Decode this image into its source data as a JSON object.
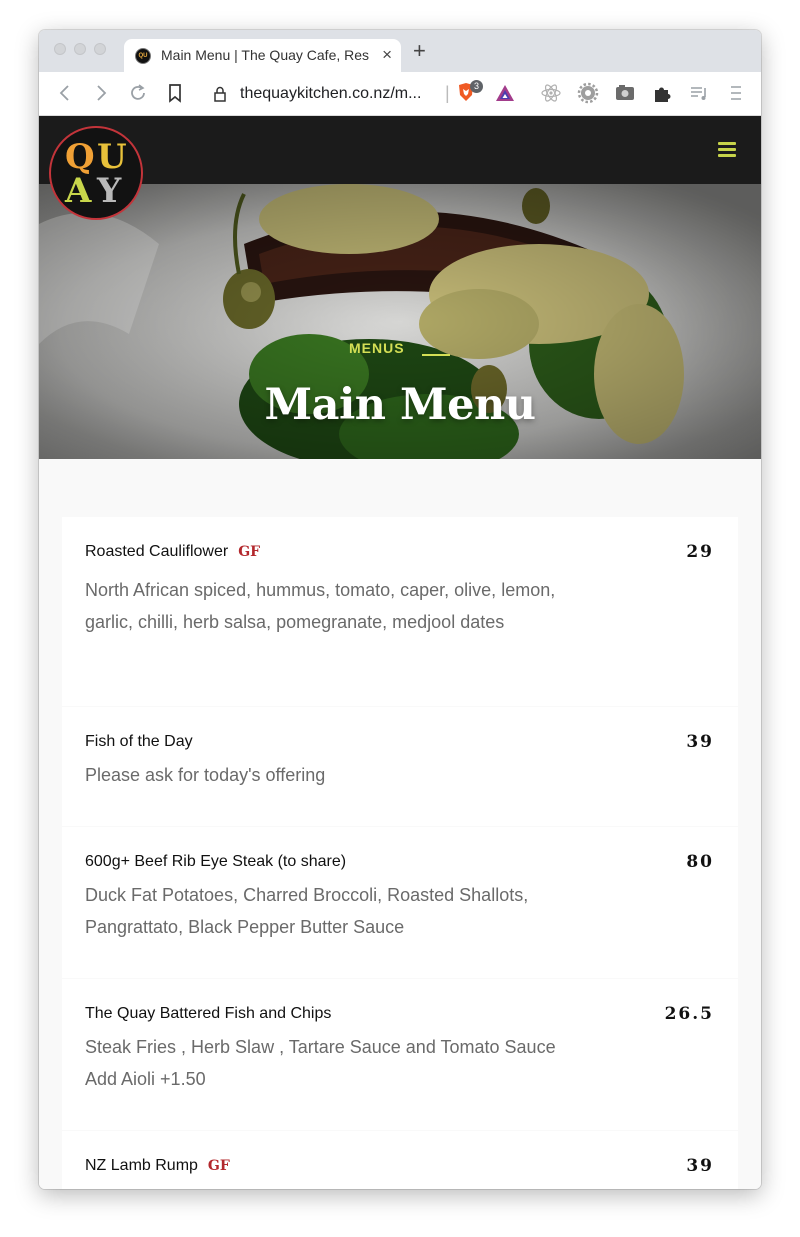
{
  "browser": {
    "tab_title": "Main Menu | The Quay Cafe, Res",
    "tab_close": "×",
    "new_tab": "+",
    "url": "thequaykitchen.co.nz/m...",
    "url_separator": "|",
    "brave_badge_count": "3"
  },
  "site": {
    "logo_letters": [
      "Q",
      "U",
      "A",
      "Y"
    ],
    "logo_colors": [
      "#f0a035",
      "#e8c13a",
      "#c8d64b",
      "#b9b9b9"
    ],
    "accent_color": "#d4df55",
    "price_accent_color": "#b3282d"
  },
  "hero": {
    "category": "MENUS",
    "title": "Main Menu"
  },
  "menu": {
    "items": [
      {
        "name": "Roasted Cauliflower",
        "badge": "GF",
        "price": "29",
        "description": "North African spiced, hummus, tomato, caper, olive, lemon, garlic, chilli, herb salsa, pomegranate, medjool dates"
      },
      {
        "name": "Fish of the Day",
        "badge": "",
        "price": "39",
        "description": "Please ask for today's offering"
      },
      {
        "name": "600g+ Beef Rib Eye Steak (to share)",
        "badge": "",
        "price": "80",
        "description": "Duck Fat Potatoes, Charred Broccoli, Roasted Shallots, Pangrattato, Black Pepper Butter Sauce"
      },
      {
        "name": "The Quay Battered Fish and Chips",
        "badge": "",
        "price": "26.5",
        "description": "Steak Fries , Herb Slaw , Tartare Sauce and Tomato Sauce",
        "description_extra": "Add Aioli +1.50"
      },
      {
        "name": "NZ Lamb Rump",
        "badge": "GF",
        "price": "39",
        "description": ""
      }
    ]
  }
}
